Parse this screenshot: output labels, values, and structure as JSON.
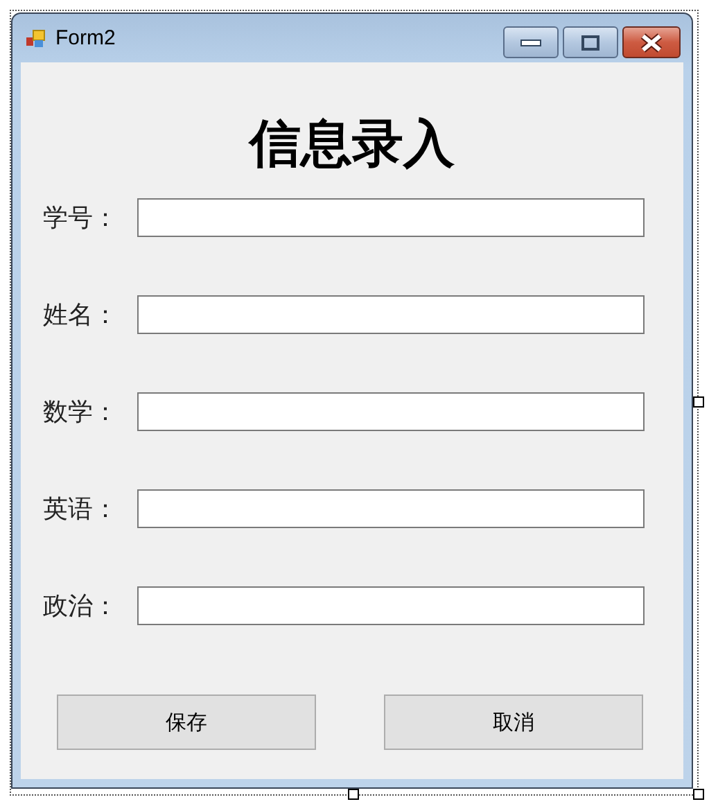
{
  "window": {
    "title": "Form2"
  },
  "heading": "信息录入",
  "fields": [
    {
      "label": "学号："
    },
    {
      "label": "姓名："
    },
    {
      "label": "数学："
    },
    {
      "label": "英语："
    },
    {
      "label": "政治："
    }
  ],
  "buttons": [
    "保存",
    "取消"
  ]
}
